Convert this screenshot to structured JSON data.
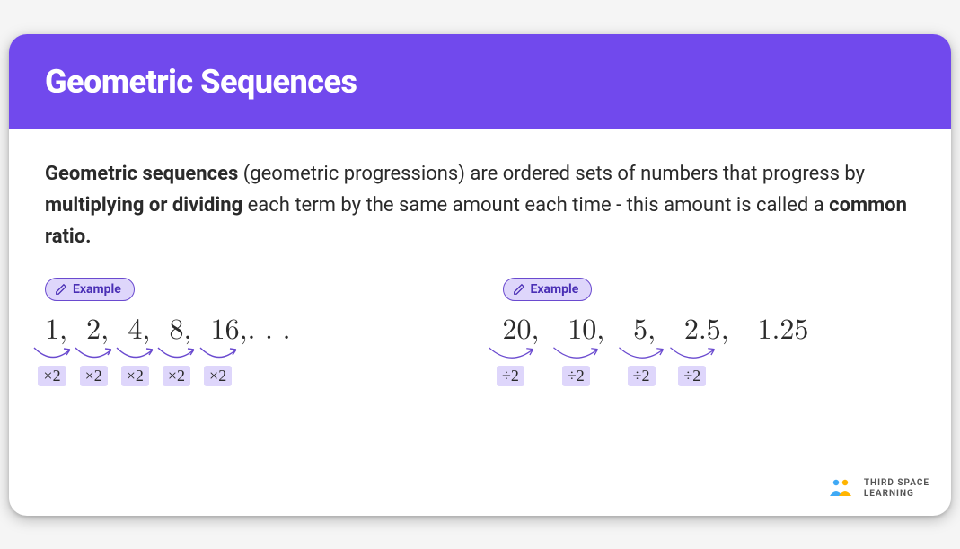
{
  "header": {
    "title": "Geometric Sequences"
  },
  "definition": {
    "lead_bold": "Geometric sequences",
    "text1": " (geometric progressions) are ordered sets of numbers that progress by ",
    "bold2": "multiplying or dividing",
    "text2": " each term by the same amount each time - this amount is called a ",
    "bold3": "common ratio."
  },
  "badge_label": "Example",
  "example1": {
    "terms": [
      "1,  ",
      "2,  ",
      "4,  ",
      "8,  ",
      "16,"
    ],
    "tail": " . . .",
    "ops": [
      "×2",
      "×2",
      "×2",
      "×2",
      "×2"
    ]
  },
  "example2": {
    "terms": [
      "20,   ",
      "10,   ",
      "5,   ",
      "2.5,   ",
      "1.25"
    ],
    "ops": [
      "÷2",
      "÷2",
      "÷2",
      "÷2"
    ]
  },
  "logo": {
    "line1": "THIRD SPACE",
    "line2": "LEARNING"
  },
  "colors": {
    "accent": "#7149ED",
    "badge_bg": "#DED6FB",
    "arrow": "#6A4ACF"
  }
}
